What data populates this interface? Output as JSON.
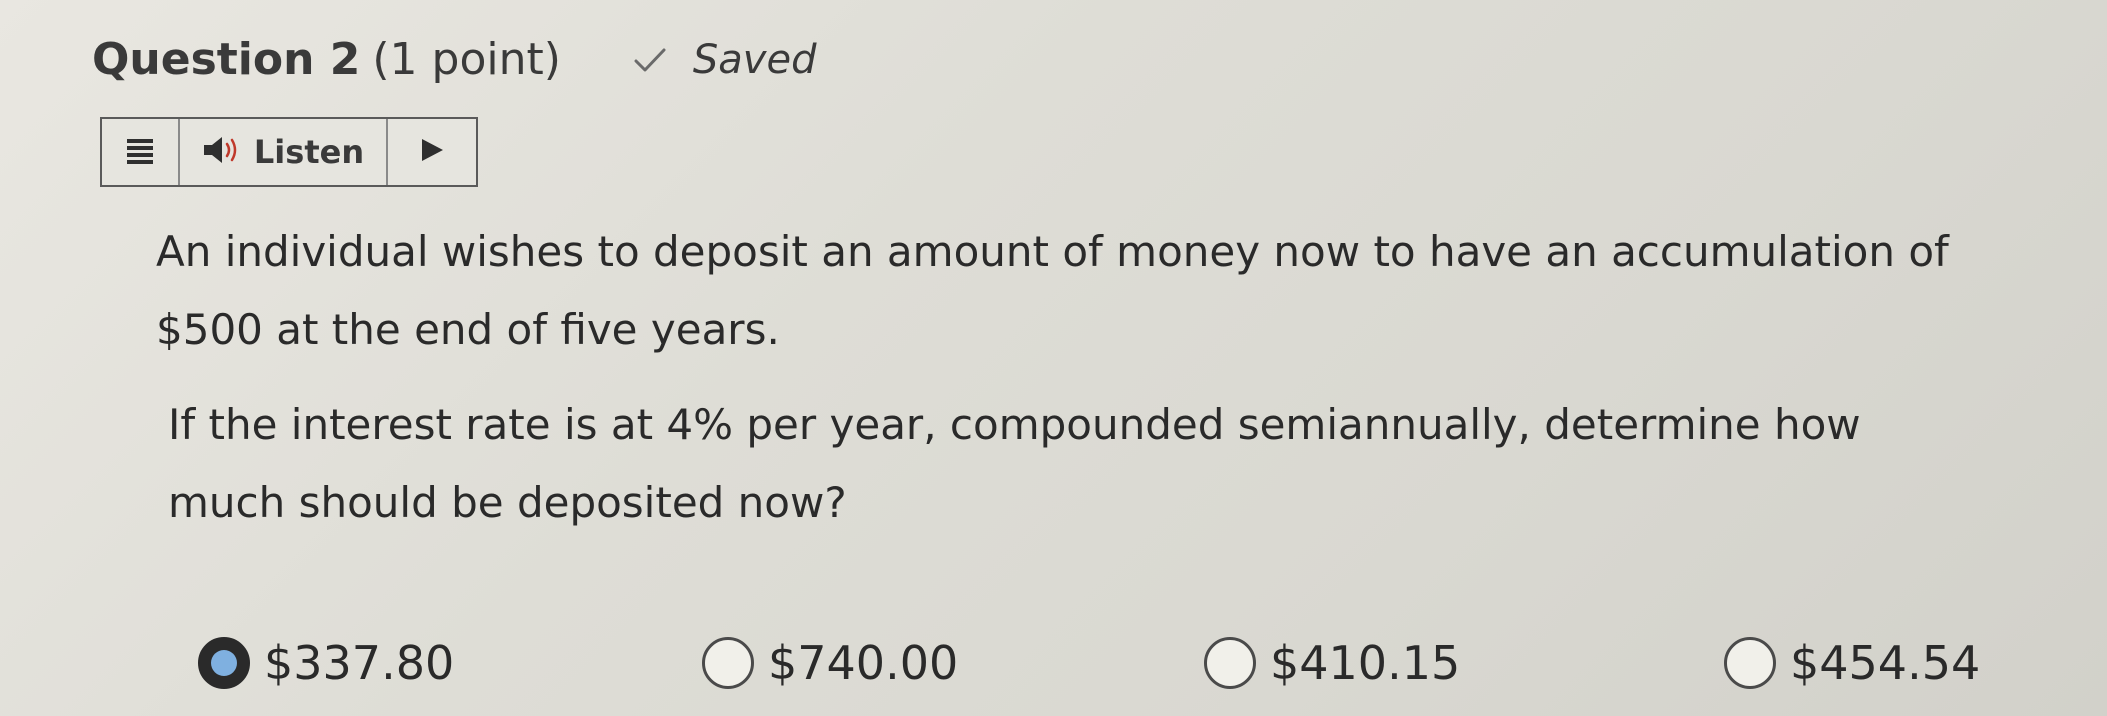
{
  "header": {
    "question_label": "Question 2",
    "points_label": "(1 point)",
    "status_icon": "check-icon",
    "status_text": "Saved"
  },
  "listen_bar": {
    "menu_icon": "menu-icon",
    "speaker_icon": "speaker-icon",
    "listen_label": "Listen",
    "play_icon": "play-icon"
  },
  "question": {
    "paragraph_1": "An individual wishes to deposit an amount of money now to have an accumulation of $500 at the end of five years.",
    "paragraph_2": "If the interest rate is at 4% per year, compounded semiannually, determine how much should be deposited now?"
  },
  "options": [
    {
      "label": "$337.80",
      "selected": true
    },
    {
      "label": "$740.00",
      "selected": false
    },
    {
      "label": "$410.15",
      "selected": false
    },
    {
      "label": "$454.54",
      "selected": false
    }
  ],
  "colors": {
    "background": "#e3e2dc",
    "text": "#2a2a2a",
    "border": "#5a5a5a",
    "selected_radio_inner": "#7fb0e0"
  }
}
